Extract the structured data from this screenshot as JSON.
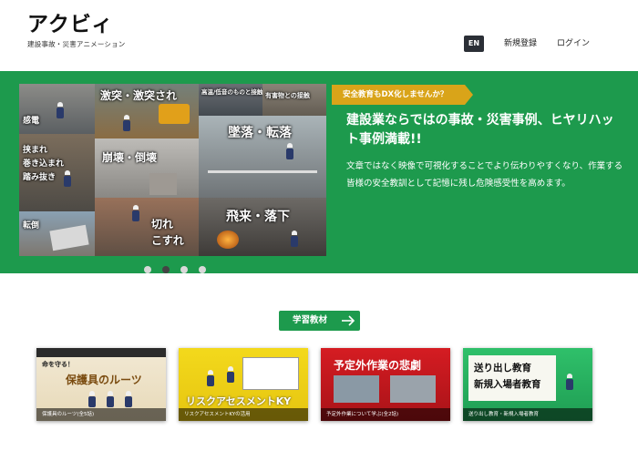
{
  "header": {
    "logo_text": "アクビィ",
    "logo_tagline": "建設事故・災害アニメーション",
    "lang_button": "EN",
    "register_link": "新規登録",
    "login_link": "ログイン"
  },
  "hero": {
    "badge": "安全教育もDX化しませんか？",
    "title": "建設業ならではの事故・災害事例、ヒヤリハット事例満載!!",
    "description": "文章ではなく映像で可視化することでより伝わりやすくなり、作業する皆様の安全教訓として記憶に残し危険感受性を高めます。",
    "collage_labels": {
      "shock": "感電",
      "caught": "挟まれ",
      "entangled": "巻き込まれ",
      "stepout": "踏み抜き",
      "overturn": "転倒",
      "collision": "激突・激突され",
      "noise": "高温/低音のものと接触",
      "harmful": "有害物との接触",
      "fall": "墜落・転落",
      "collapse": "崩壊・倒壊",
      "cut": "切れ",
      "scrape": "こすれ",
      "flying": "飛来・落下"
    },
    "carousel_slide_count": 4,
    "carousel_active_index": 1
  },
  "materials": {
    "button_label": "学習教材",
    "cards": [
      {
        "title_top": "命を守る！",
        "title_main": "保護具のルーツ",
        "caption": "保護具のルーツ(全5話)"
      },
      {
        "title_top": "",
        "title_main": "リスクアセスメントKY",
        "caption": "リスクアセスメントKYの活用"
      },
      {
        "title_top": "",
        "title_main": "予定外作業の悲劇",
        "caption": "予定外作業について学ぶ(全2話)"
      },
      {
        "title_top": "送り出し教育",
        "title_main": "新規入場者教育",
        "caption": "送り出し教育・新規入場者教育"
      }
    ]
  },
  "colors": {
    "brand_green": "#1d9a4d",
    "badge_gold": "#d9a419",
    "dark_button": "#2b2f36"
  }
}
